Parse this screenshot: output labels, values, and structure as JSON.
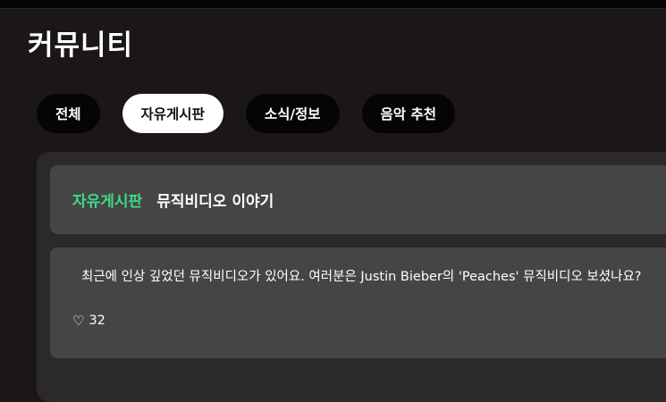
{
  "page": {
    "title": "커뮤니티"
  },
  "tabs": [
    {
      "label": "전체",
      "active": false
    },
    {
      "label": "자유게시판",
      "active": true
    },
    {
      "label": "소식/정보",
      "active": false
    },
    {
      "label": "음악 추천",
      "active": false
    }
  ],
  "post": {
    "category": "자유게시판",
    "title": "뮤직비디오 이야기",
    "body": "최근에 인상 깊었던 뮤직비디오가 있어요. 여러분은 Justin Bieber의 'Peaches' 뮤직비디오 보셨나요?",
    "likes": "32",
    "like_icon": "heart-outline-icon"
  },
  "colors": {
    "background": "#1c1717",
    "panel": "#2b2929",
    "card": "#464545",
    "accent": "#3ddc84",
    "tab_inactive": "#050505",
    "tab_active": "#ffffff"
  }
}
